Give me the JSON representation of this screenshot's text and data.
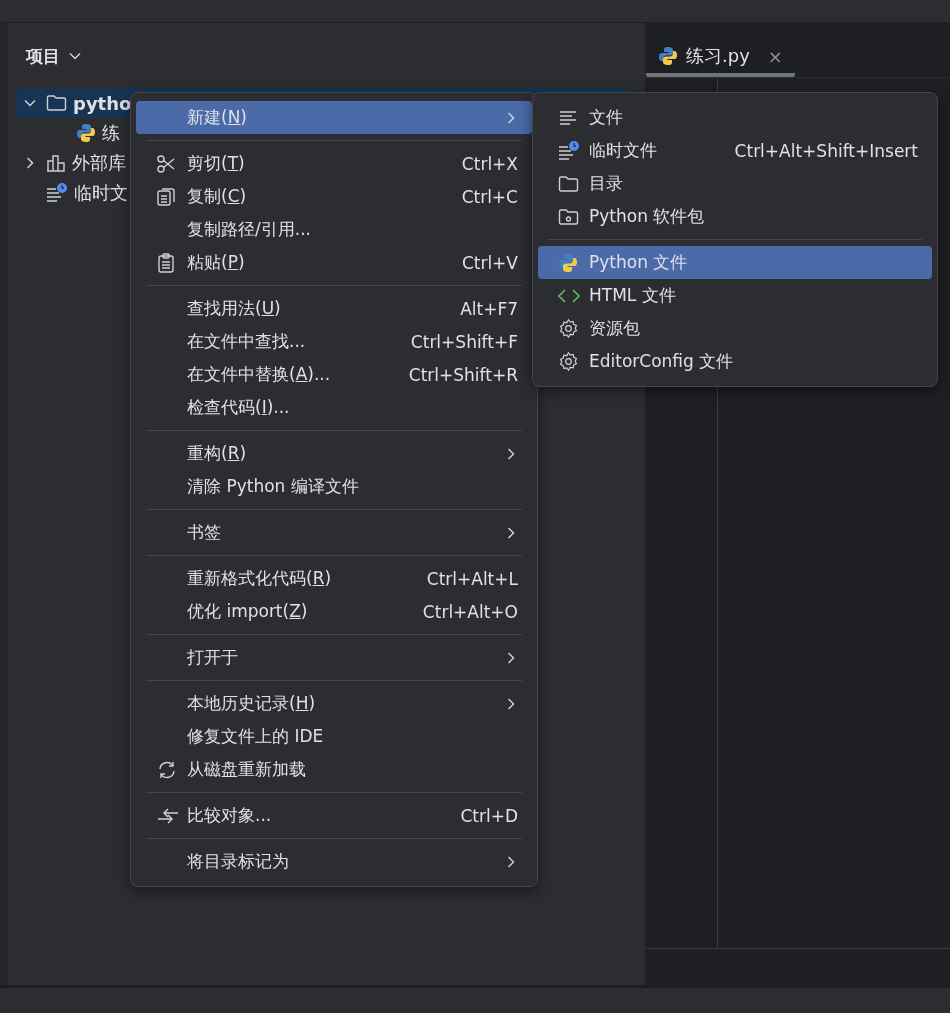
{
  "project_panel": {
    "title": "项目",
    "tree": [
      {
        "label": "pytho",
        "kind": "folder",
        "expanded": true,
        "selected": true,
        "children": [
          {
            "label": "练",
            "kind": "python",
            "selected": false
          }
        ]
      },
      {
        "label": "外部库",
        "kind": "library",
        "expanded": false,
        "selected": false
      },
      {
        "label": "临时文",
        "kind": "scratch",
        "selected": false
      }
    ]
  },
  "editor": {
    "tabs": [
      {
        "label": "练习.py",
        "close": "×",
        "selected": true
      }
    ]
  },
  "context_menu": {
    "items": [
      {
        "kind": "plain",
        "label": "新建(",
        "mnemonic": "N",
        "label_end": ")",
        "submenu": true,
        "selected": true
      },
      {
        "kind": "separator"
      },
      {
        "kind": "cut",
        "label": "剪切(",
        "mnemonic": "T",
        "label_end": ")",
        "shortcut": "Ctrl+X",
        "submenu": false,
        "selected": false
      },
      {
        "kind": "copy",
        "label": "复制(",
        "mnemonic": "C",
        "label_end": ")",
        "shortcut": "Ctrl+C",
        "submenu": false,
        "selected": false
      },
      {
        "kind": "plain",
        "label": "复制路径/引用...",
        "submenu": false,
        "selected": false
      },
      {
        "kind": "paste",
        "label": "粘贴(",
        "mnemonic": "P",
        "label_end": ")",
        "shortcut": "Ctrl+V",
        "submenu": false,
        "selected": false
      },
      {
        "kind": "separator"
      },
      {
        "kind": "plain",
        "label": "查找用法(",
        "mnemonic": "U",
        "label_end": ")",
        "shortcut": "Alt+F7",
        "submenu": false,
        "selected": false
      },
      {
        "kind": "plain",
        "label": "在文件中查找...",
        "shortcut": "Ctrl+Shift+F",
        "submenu": false,
        "selected": false
      },
      {
        "kind": "plain",
        "label": "在文件中替换(",
        "mnemonic": "A",
        "label_end": ")...",
        "shortcut": "Ctrl+Shift+R",
        "submenu": false,
        "selected": false
      },
      {
        "kind": "plain",
        "label": "检查代码(",
        "mnemonic": "I",
        "label_end": ")...",
        "submenu": false,
        "selected": false
      },
      {
        "kind": "separator"
      },
      {
        "kind": "plain",
        "label": "重构(",
        "mnemonic": "R",
        "label_end": ")",
        "submenu": true,
        "selected": false
      },
      {
        "kind": "plain",
        "label": "清除 Python 编译文件",
        "submenu": false,
        "selected": false
      },
      {
        "kind": "separator"
      },
      {
        "kind": "plain",
        "label": "书签",
        "submenu": true,
        "selected": false
      },
      {
        "kind": "separator"
      },
      {
        "kind": "plain",
        "label": "重新格式化代码(",
        "mnemonic": "R",
        "label_end": ")",
        "shortcut": "Ctrl+Alt+L",
        "submenu": false,
        "selected": false
      },
      {
        "kind": "plain",
        "label": "优化 import(",
        "mnemonic": "Z",
        "label_end": ")",
        "shortcut": "Ctrl+Alt+O",
        "submenu": false,
        "selected": false
      },
      {
        "kind": "separator"
      },
      {
        "kind": "plain",
        "label": "打开于",
        "submenu": true,
        "selected": false
      },
      {
        "kind": "separator"
      },
      {
        "kind": "plain",
        "label": "本地历史记录(",
        "mnemonic": "H",
        "label_end": ")",
        "submenu": true,
        "selected": false
      },
      {
        "kind": "plain",
        "label": "修复文件上的 IDE",
        "submenu": false,
        "selected": false
      },
      {
        "kind": "reload",
        "label": "从磁盘重新加载",
        "submenu": false,
        "selected": false
      },
      {
        "kind": "separator"
      },
      {
        "kind": "compare",
        "label": "比较对象...",
        "shortcut": "Ctrl+D",
        "submenu": false,
        "selected": false
      },
      {
        "kind": "separator"
      },
      {
        "kind": "plain",
        "label": "将目录标记为",
        "submenu": true,
        "selected": false
      }
    ]
  },
  "new_submenu": {
    "items": [
      {
        "kind": "file",
        "label": "文件",
        "selected": false
      },
      {
        "kind": "scratch",
        "label": "临时文件",
        "shortcut": "Ctrl+Alt+Shift+Insert",
        "selected": false
      },
      {
        "kind": "folder",
        "label": "目录",
        "selected": false
      },
      {
        "kind": "package",
        "label": "Python 软件包",
        "selected": false
      },
      {
        "kind": "separator"
      },
      {
        "kind": "python",
        "label": "Python 文件",
        "selected": true
      },
      {
        "kind": "html",
        "label": "HTML 文件",
        "selected": false
      },
      {
        "kind": "gear",
        "label": "资源包",
        "selected": false
      },
      {
        "kind": "gear",
        "label": "EditorConfig 文件",
        "selected": false
      }
    ]
  }
}
